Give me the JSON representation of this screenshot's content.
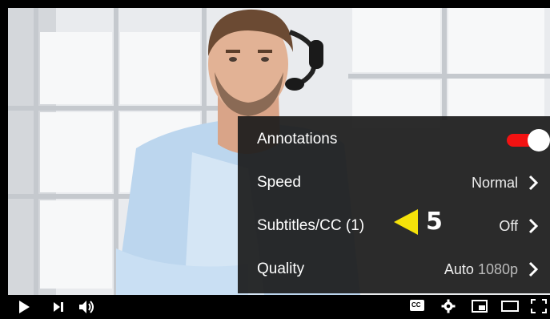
{
  "menu": {
    "items": [
      {
        "label": "Annotations",
        "value": "",
        "control": "toggle",
        "state": "on"
      },
      {
        "label": "Speed",
        "value": "Normal",
        "control": "chevron"
      },
      {
        "label": "Subtitles/CC (1)",
        "value": "Off",
        "control": "chevron"
      },
      {
        "label": "Quality",
        "value": "Auto",
        "value_detail": "1080p",
        "control": "chevron"
      }
    ]
  },
  "callout": {
    "number": "5",
    "color": "#f5e20a"
  },
  "controls": {
    "left": [
      "play-icon",
      "next-icon",
      "volume-icon"
    ],
    "right": [
      "captions-icon",
      "settings-icon",
      "miniplayer-icon",
      "theater-icon",
      "fullscreen-icon"
    ],
    "cc_label": "CC"
  },
  "colors": {
    "toggle_on": "#f31212",
    "menu_bg": "#1c1c1c"
  }
}
